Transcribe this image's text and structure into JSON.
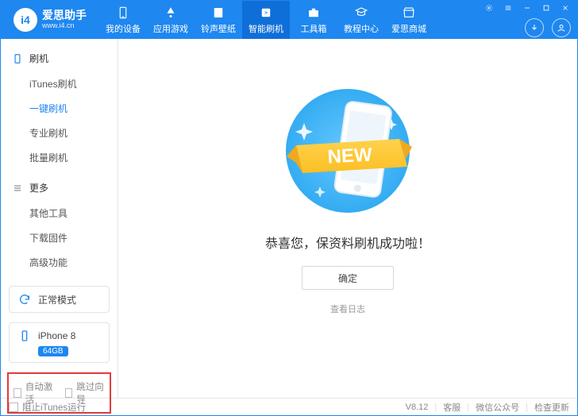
{
  "app": {
    "title": "爱思助手",
    "subtitle": "www.i4.cn",
    "version": "V8.12"
  },
  "nav": {
    "items": [
      {
        "label": "我的设备"
      },
      {
        "label": "应用游戏"
      },
      {
        "label": "铃声壁纸"
      },
      {
        "label": "智能刷机"
      },
      {
        "label": "工具箱"
      },
      {
        "label": "教程中心"
      },
      {
        "label": "爱思商城"
      }
    ]
  },
  "sidebar": {
    "group_flash": "刷机",
    "group_more": "更多",
    "flash_items": [
      {
        "label": "iTunes刷机"
      },
      {
        "label": "一键刷机"
      },
      {
        "label": "专业刷机"
      },
      {
        "label": "批量刷机"
      }
    ],
    "more_items": [
      {
        "label": "其他工具"
      },
      {
        "label": "下载固件"
      },
      {
        "label": "高级功能"
      }
    ],
    "mode_card": "正常模式",
    "device_name": "iPhone 8",
    "device_storage": "64GB",
    "auto_activate_label": "自动激活",
    "skip_guide_label": "跳过向导"
  },
  "main": {
    "new_badge": "NEW",
    "headline": "恭喜您，保资料刷机成功啦！",
    "ok_button": "确定",
    "view_log": "查看日志"
  },
  "footer": {
    "block_itunes": "阻止iTunes运行",
    "support": "客服",
    "wechat": "微信公众号",
    "check_update": "检查更新"
  }
}
